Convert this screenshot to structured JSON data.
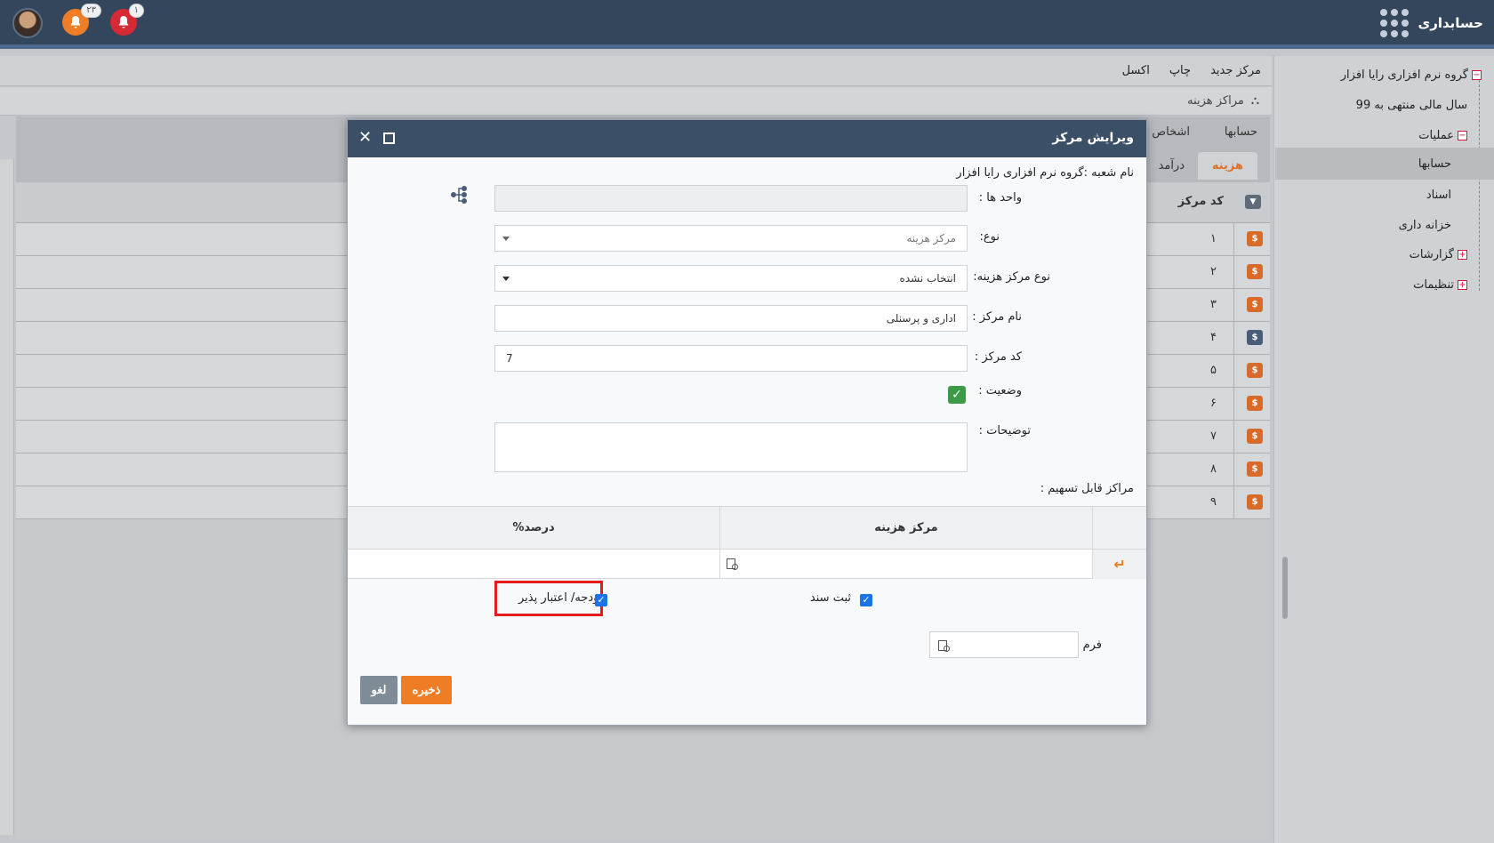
{
  "app": {
    "title": "حسابداری"
  },
  "header": {
    "notif_count": "۲۳",
    "alert_count": "۱"
  },
  "sidebar": {
    "items": [
      {
        "label": "گروه نرم افزاری رایا افزار",
        "box": "−"
      },
      {
        "label": "سال مالی منتهی به 99",
        "box": ""
      },
      {
        "label": "عملیات",
        "box": "−"
      },
      {
        "label": "حسابها",
        "box": ""
      },
      {
        "label": "اسناد",
        "box": ""
      },
      {
        "label": "خزانه داری",
        "box": ""
      },
      {
        "label": "گزارشات",
        "box": "+"
      },
      {
        "label": "تنظیمات",
        "box": "+"
      }
    ]
  },
  "toolbar": {
    "new_center": "مرکز جدید",
    "print": "چاپ",
    "excel": "اکسل"
  },
  "breadcrumb": {
    "label": "مراکز هزینه"
  },
  "tabs": {
    "accounts": "حسابها",
    "persons": "اشخاص",
    "cost": "هزینه",
    "income": "درآمد"
  },
  "table": {
    "col_code": "کد مرکز",
    "rows": [
      "۱",
      "۲",
      "۳",
      "۴",
      "۵",
      "۶",
      "۷",
      "۸",
      "۹"
    ]
  },
  "modal": {
    "title": "ویرایش مرکز",
    "branch_name": "نام شعبه :گروه نرم افزاری رایا افزار",
    "units_label": "واحد ها :",
    "type_label": "نوع:",
    "type_value": "مرکز هزینه",
    "cost_type_label": "نوع مرکز هزینه:",
    "cost_type_value": "انتخاب نشده",
    "name_label": "نام مرکز :",
    "name_value": "اداری و پرسنلی",
    "code_label": "کد مرکز :",
    "code_value": "7",
    "status_label": "وضعیت :",
    "desc_label": "توضیحات :",
    "alloc_label": "مراکز قابل تسهیم :",
    "alloc_col_center": "مرکز هزینه",
    "alloc_col_percent": "درصد%",
    "register_doc": "ثبت سند",
    "budget": "بودجه/ اعتبار پذیر",
    "form_label": "فرم",
    "save": "ذخیره",
    "cancel": "لغو"
  }
}
